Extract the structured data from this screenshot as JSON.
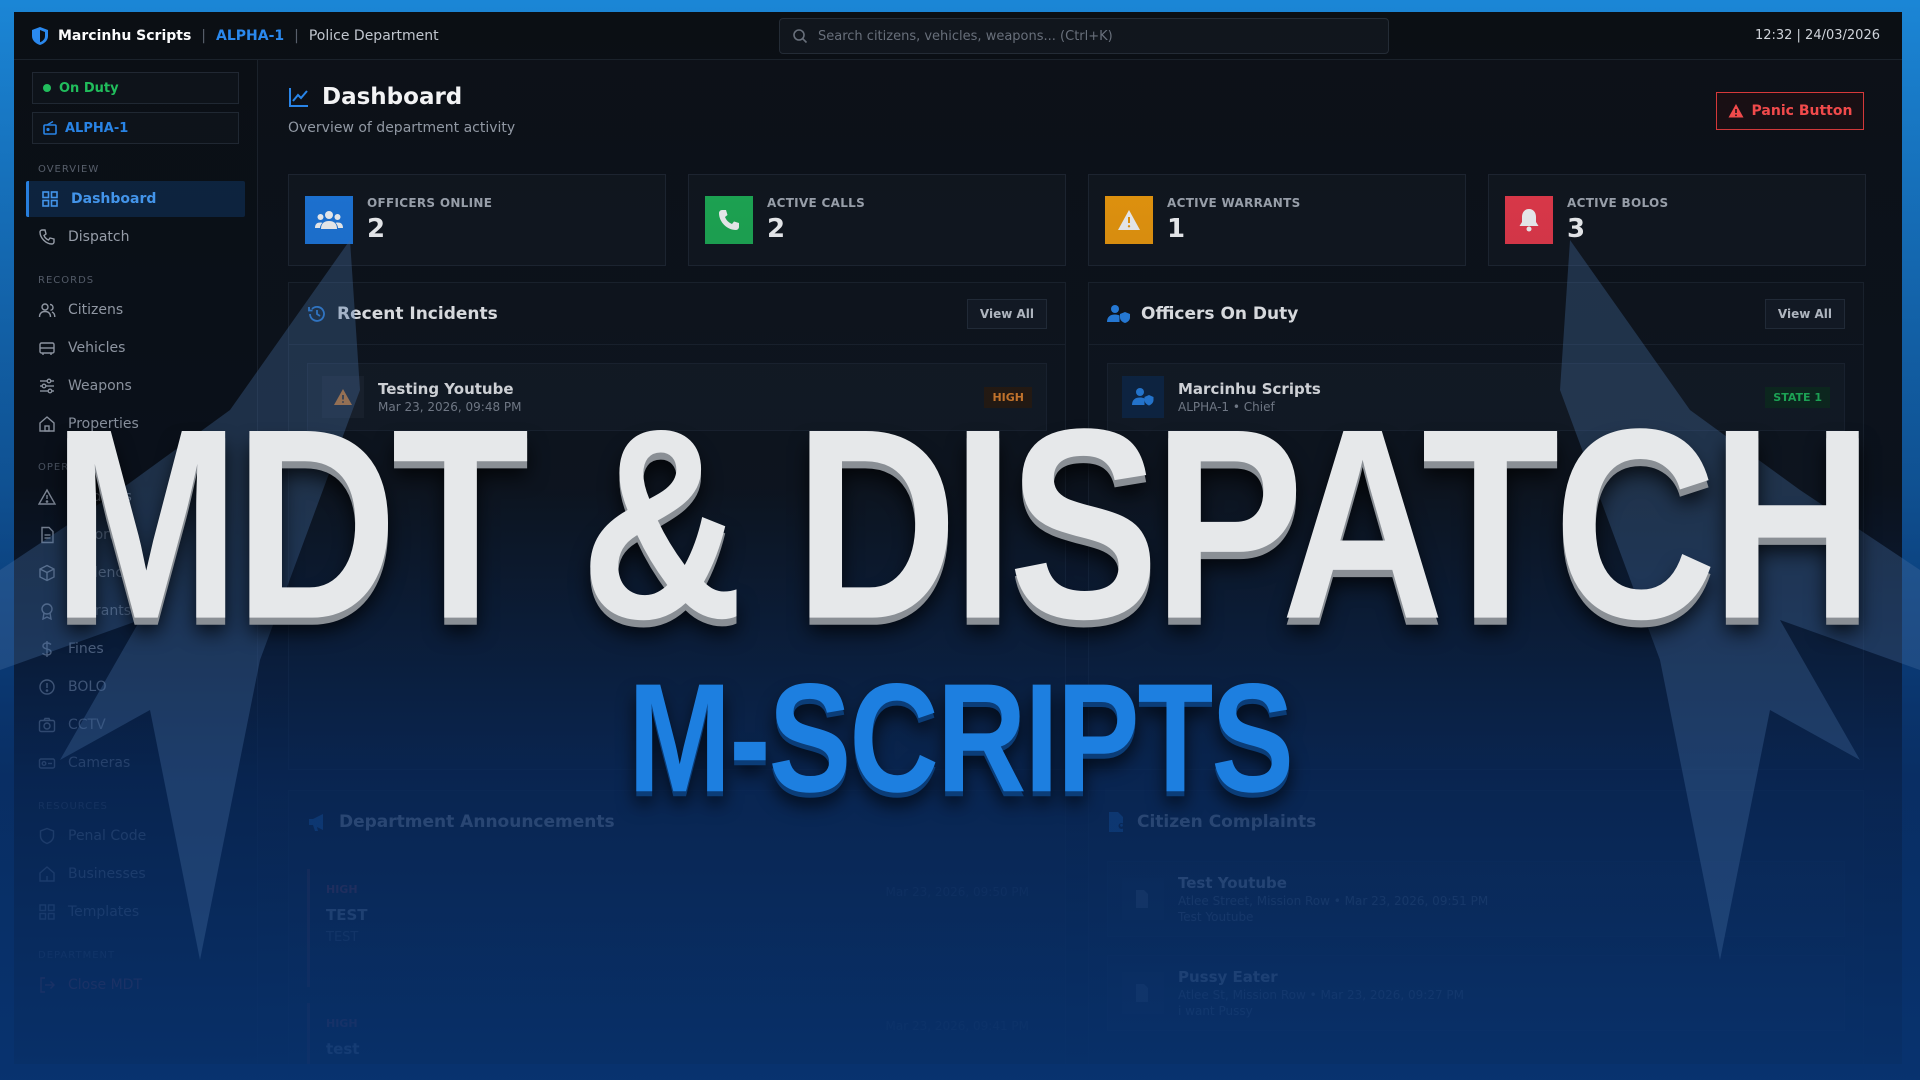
{
  "topbar": {
    "app_name": "Marcinhu Scripts",
    "separator": "|",
    "unit": "ALPHA-1",
    "department": "Police Department",
    "search_placeholder": "Search citizens, vehicles, weapons... (Ctrl+K)",
    "clock": "12:32 | 24/03/2026"
  },
  "sidebar": {
    "duty_status": "On Duty",
    "unit": "ALPHA-1",
    "sections": {
      "overview": "OVERVIEW",
      "records": "RECORDS",
      "operations": "OPERATIONS",
      "resources": "RESOURCES",
      "department": "DEPARTMENT"
    },
    "items": {
      "dashboard": "Dashboard",
      "dispatch": "Dispatch",
      "citizens": "Citizens",
      "vehicles": "Vehicles",
      "weapons": "Weapons",
      "properties": "Properties",
      "incidents": "Incidents",
      "reports": "Reports",
      "evidence": "Evidence",
      "warrants": "Warrants",
      "fines": "Fines",
      "bolo": "BOLO",
      "cctv": "CCTV",
      "cameras": "Cameras",
      "penal_code": "Penal Code",
      "businesses": "Businesses",
      "templates": "Templates",
      "close_mdt": "Close MDT"
    }
  },
  "main": {
    "title": "Dashboard",
    "subtitle": "Overview of department activity",
    "panic_label": "Panic Button",
    "stats": [
      {
        "label": "OFFICERS ONLINE",
        "value": "2",
        "color": "#1f7ae0",
        "icon": "users-icon"
      },
      {
        "label": "ACTIVE CALLS",
        "value": "2",
        "color": "#1fb155",
        "icon": "phone-icon"
      },
      {
        "label": "ACTIVE WARRANTS",
        "value": "1",
        "color": "#f59e0b",
        "icon": "warning-icon"
      },
      {
        "label": "ACTIVE BOLOS",
        "value": "3",
        "color": "#ef3b4b",
        "icon": "bell-icon"
      }
    ],
    "incidents": {
      "title": "Recent Incidents",
      "view_all": "View All",
      "items": [
        {
          "title": "Testing Youtube",
          "date": "Mar 23, 2026, 09:48 PM",
          "priority": "HIGH"
        }
      ]
    },
    "officers": {
      "title": "Officers On Duty",
      "view_all": "View All",
      "items": [
        {
          "name": "Marcinhu Scripts",
          "detail": "ALPHA-1 • Chief",
          "state": "STATE 1"
        }
      ]
    },
    "announcements": {
      "title": "Department Announcements",
      "items": [
        {
          "priority": "HIGH",
          "title": "TEST",
          "body": "TEST",
          "date": "Mar 23, 2026, 09:50 PM"
        },
        {
          "priority": "HIGH",
          "title": "test",
          "body": "",
          "date": "Mar 23, 2026, 09:41 PM"
        }
      ]
    },
    "complaints": {
      "title": "Citizen Complaints",
      "items": [
        {
          "title": "Test Youtube",
          "meta": "Atlee Street, Mission Row • Mar 23, 2026, 09:51 PM",
          "body": "Test Youtube"
        },
        {
          "title": "Pussy Eater",
          "meta": "Atlee St, Mission Row • Mar 23, 2026, 09:27 PM",
          "body": "i want Pussy"
        }
      ]
    }
  },
  "overlay": {
    "headline": "MDT & DISPATCH",
    "subline": "M-SCRIPTS"
  },
  "colors": {
    "accent": "#2b8bf2",
    "danger": "#e03b3b",
    "success": "#22c55e",
    "warning": "#f59e0b"
  }
}
